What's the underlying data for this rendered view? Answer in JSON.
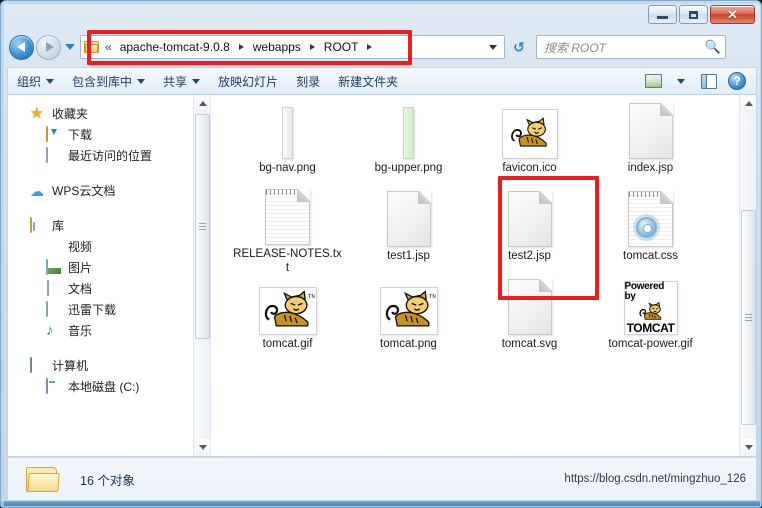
{
  "window": {
    "controls": {
      "minimize": "–",
      "maximize": "□",
      "close": "✕"
    }
  },
  "addressbar": {
    "overflow_chevron": "«",
    "crumbs": [
      "apache-tomcat-9.0.8",
      "webapps",
      "ROOT"
    ],
    "folder_icon": "folder-icon",
    "dropdown_icon": "chevron-down-icon",
    "refresh_icon": "refresh-icon",
    "refresh_glyph": "↺"
  },
  "search": {
    "placeholder": "搜索 ROOT",
    "value": "",
    "icon": "search-icon"
  },
  "toolbar": {
    "items": [
      {
        "label": "组织",
        "has_caret": true
      },
      {
        "label": "包含到库中",
        "has_caret": true
      },
      {
        "label": "共享",
        "has_caret": true
      },
      {
        "label": "放映幻灯片",
        "has_caret": false
      },
      {
        "label": "刻录",
        "has_caret": false
      },
      {
        "label": "新建文件夹",
        "has_caret": false
      }
    ],
    "views_icon": "view-layout-icon",
    "views_caret": "chevron-down-icon",
    "preview_pane_icon": "preview-pane-icon",
    "help_icon": "help-icon",
    "help_glyph": "?"
  },
  "navpane": {
    "groups": [
      {
        "header": {
          "label": "收藏夹",
          "icon": "star-icon"
        },
        "children": [
          {
            "label": "下载",
            "icon": "downloads-icon"
          },
          {
            "label": "最近访问的位置",
            "icon": "recent-places-icon"
          }
        ]
      },
      {
        "header": {
          "label": "WPS云文档",
          "icon": "cloud-icon"
        },
        "children": []
      },
      {
        "header": {
          "label": "库",
          "icon": "library-icon"
        },
        "children": [
          {
            "label": "视频",
            "icon": "video-icon"
          },
          {
            "label": "图片",
            "icon": "pictures-icon"
          },
          {
            "label": "文档",
            "icon": "documents-icon"
          },
          {
            "label": "迅雷下载",
            "icon": "thunder-download-icon"
          },
          {
            "label": "音乐",
            "icon": "music-icon"
          }
        ]
      },
      {
        "header": {
          "label": "计算机",
          "icon": "computer-icon"
        },
        "children": [
          {
            "label": "本地磁盘 (C:)",
            "icon": "local-disk-icon"
          }
        ]
      }
    ]
  },
  "files": [
    {
      "name": "bg-nav.png",
      "icon": "image-bar-grey"
    },
    {
      "name": "bg-upper.png",
      "icon": "image-bar-green"
    },
    {
      "name": "favicon.ico",
      "icon": "tomcat-cat-framed"
    },
    {
      "name": "index.jsp",
      "icon": "blank-page"
    },
    {
      "name": "RELEASE-NOTES.txt",
      "icon": "notepad-text"
    },
    {
      "name": "test1.jsp",
      "icon": "blank-page"
    },
    {
      "name": "test2.jsp",
      "icon": "blank-page",
      "highlighted": true
    },
    {
      "name": "tomcat.css",
      "icon": "notepad-gear"
    },
    {
      "name": "tomcat.gif",
      "icon": "tomcat-cat"
    },
    {
      "name": "tomcat.png",
      "icon": "tomcat-cat"
    },
    {
      "name": "tomcat.svg",
      "icon": "blank-page"
    },
    {
      "name": "tomcat-power.gif",
      "icon": "tomcat-powered",
      "powered_top": "Powered by",
      "powered_bottom": "TOMCAT"
    }
  ],
  "statusbar": {
    "folder_icon": "folder-icon",
    "item_count_text": "16 个对象"
  },
  "watermark": "https://blog.csdn.net/mingzhuo_126",
  "annotations": {
    "address_box_color": "#ee1c1c",
    "file_box_color": "#ee1c1c"
  }
}
